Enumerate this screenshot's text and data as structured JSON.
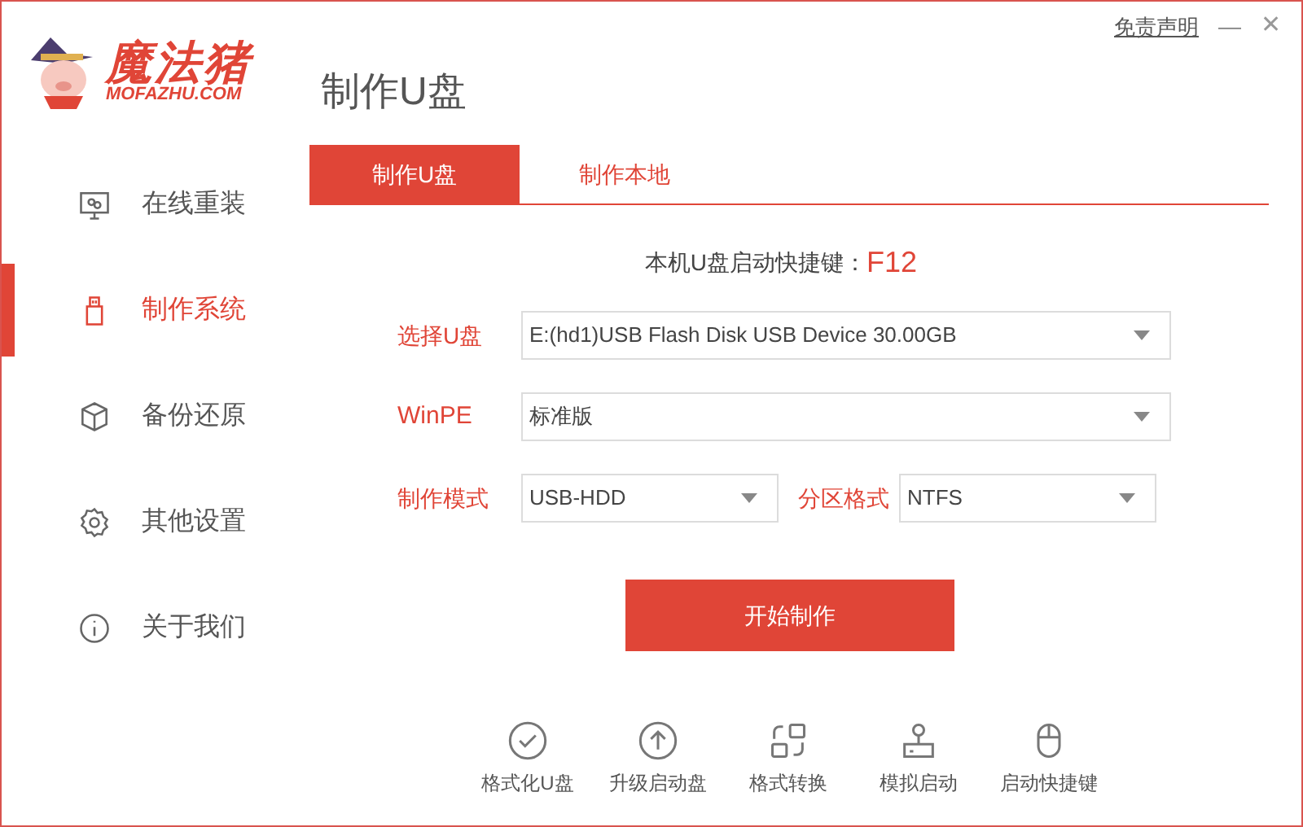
{
  "window": {
    "logo": {
      "name": "魔法猪",
      "domain": "MOFAZHU.COM"
    },
    "title": "制作U盘",
    "disclaimer": "免责声明",
    "minimize": "—",
    "close": "✕"
  },
  "sidebar": {
    "items": [
      {
        "label": "在线重装",
        "selected": false
      },
      {
        "label": "制作系统",
        "selected": true
      },
      {
        "label": "备份还原",
        "selected": false
      },
      {
        "label": "其他设置",
        "selected": false
      },
      {
        "label": "关于我们",
        "selected": false
      }
    ]
  },
  "tabs": [
    {
      "label": "制作U盘",
      "selected": true
    },
    {
      "label": "制作本地",
      "selected": false
    }
  ],
  "hotkey": {
    "label": "本机U盘启动快捷键：",
    "value": "F12"
  },
  "form": {
    "usb": {
      "label": "选择U盘",
      "value": "E:(hd1)USB Flash Disk USB Device 30.00GB"
    },
    "winpe": {
      "label": "WinPE",
      "value": "标准版"
    },
    "mode": {
      "label": "制作模式",
      "value": "USB-HDD"
    },
    "partition": {
      "label": "分区格式",
      "value": "NTFS"
    }
  },
  "start_button": "开始制作",
  "tools": [
    {
      "label": "格式化U盘"
    },
    {
      "label": "升级启动盘"
    },
    {
      "label": "格式转换"
    },
    {
      "label": "模拟启动"
    },
    {
      "label": "启动快捷键"
    }
  ]
}
